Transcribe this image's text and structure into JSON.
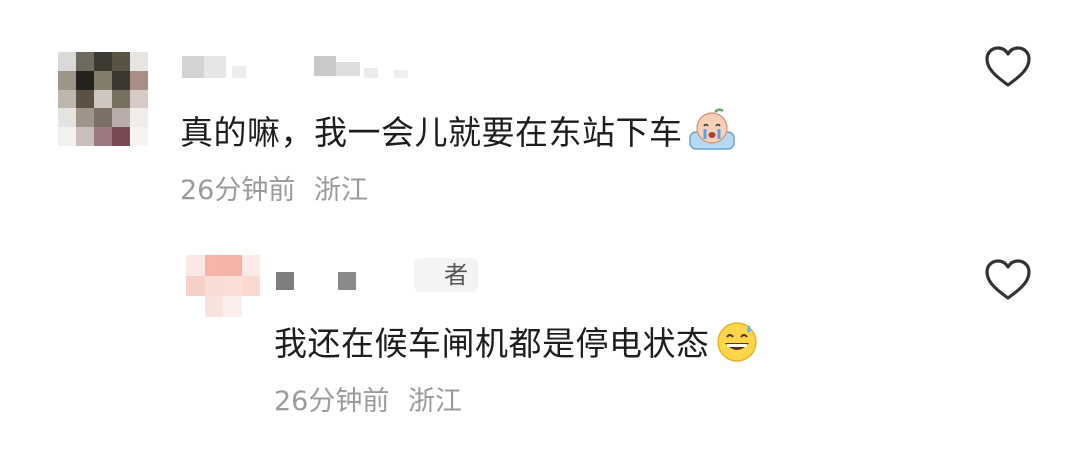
{
  "comments": [
    {
      "text": "真的嘛，我一会儿就要在东站下车",
      "emoji": "crying-face-emoji",
      "time": "26分钟前",
      "location": "浙江"
    },
    {
      "badge": "者",
      "text": "我还在候车闸机都是停电状态",
      "emoji": "grinning-sweat-emoji",
      "time": "26分钟前",
      "location": "浙江"
    }
  ],
  "icons": {
    "like": "heart-outline-icon"
  },
  "colors": {
    "text": "#1e1e1e",
    "meta": "#9b9b9b",
    "icon": "#333333"
  }
}
